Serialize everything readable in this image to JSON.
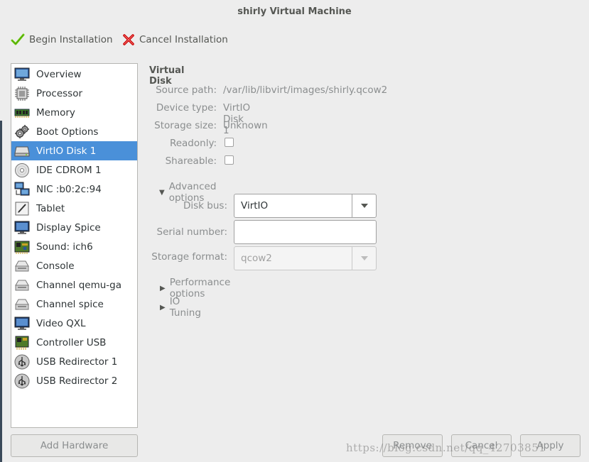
{
  "window": {
    "title": "shirly Virtual Machine"
  },
  "toolbar": {
    "begin_label": "Begin Installation",
    "cancel_label": "Cancel Installation"
  },
  "sidebar": {
    "items": [
      {
        "label": "Overview",
        "icon": "monitor-icon"
      },
      {
        "label": "Processor",
        "icon": "cpu-icon"
      },
      {
        "label": "Memory",
        "icon": "memory-icon"
      },
      {
        "label": "Boot Options",
        "icon": "gears-icon"
      },
      {
        "label": "VirtIO Disk 1",
        "icon": "harddisk-icon",
        "selected": true
      },
      {
        "label": "IDE CDROM 1",
        "icon": "cdrom-icon"
      },
      {
        "label": "NIC :b0:2c:94",
        "icon": "network-icon"
      },
      {
        "label": "Tablet",
        "icon": "tablet-icon"
      },
      {
        "label": "Display Spice",
        "icon": "display-icon"
      },
      {
        "label": "Sound: ich6",
        "icon": "sound-icon"
      },
      {
        "label": "Console",
        "icon": "serial-icon"
      },
      {
        "label": "Channel qemu-ga",
        "icon": "serial-icon"
      },
      {
        "label": "Channel spice",
        "icon": "serial-icon"
      },
      {
        "label": "Video QXL",
        "icon": "display-icon"
      },
      {
        "label": "Controller USB",
        "icon": "controller-icon"
      },
      {
        "label": "USB Redirector 1",
        "icon": "usb-icon"
      },
      {
        "label": "USB Redirector 2",
        "icon": "usb-icon"
      }
    ],
    "add_hardware_label": "Add Hardware"
  },
  "disk": {
    "section_title": "Virtual Disk",
    "source_path_label": "Source path:",
    "source_path_value": "/var/lib/libvirt/images/shirly.qcow2",
    "device_type_label": "Device type:",
    "device_type_value": "VirtIO Disk 1",
    "storage_size_label": "Storage size:",
    "storage_size_value": "Unknown",
    "readonly_label": "Readonly:",
    "shareable_label": "Shareable:",
    "advanced_label": "Advanced options",
    "disk_bus_label": "Disk bus:",
    "disk_bus_value": "VirtIO",
    "serial_label": "Serial number:",
    "serial_value": "",
    "format_label": "Storage format:",
    "format_value": "qcow2",
    "performance_label": "Performance options",
    "io_label": "IO Tuning"
  },
  "footer": {
    "remove_label": "Remove",
    "cancel_label": "Cancel",
    "apply_label": "Apply"
  },
  "watermark": "https://blog.csdn.net/qq_42703851",
  "colors": {
    "selection": "#4a90d9",
    "check_green": "#73d216",
    "cancel_red": "#cc0000"
  }
}
